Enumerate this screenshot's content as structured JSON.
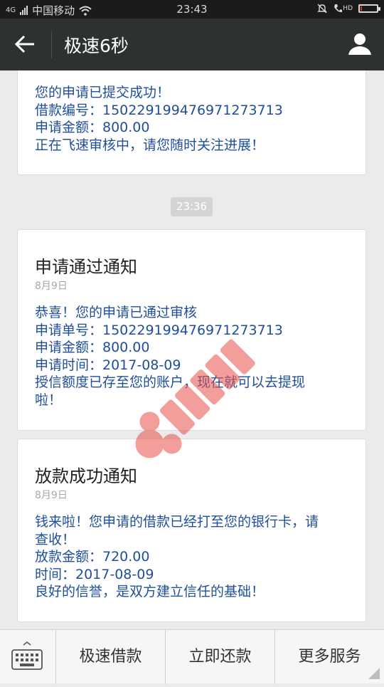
{
  "status_bar": {
    "signal_text": "4G",
    "carrier": "中国移动",
    "time": "23:43",
    "hd": "HD",
    "battery_level": 0.08,
    "battery_color": "#e03030"
  },
  "header": {
    "back_icon": "arrow-left-icon",
    "title": "极速6秒",
    "profile_icon": "person-icon"
  },
  "messages": [
    {
      "lines": [
        "您的申请已提交成功！",
        "借款编号：150229199476971273713",
        "申请金额：800.00",
        "正在飞速审核中，请您随时关注进展！"
      ]
    },
    {
      "timestamp": "23:36"
    },
    {
      "title": "申请通过通知",
      "date": "8月9日",
      "lines": [
        "恭喜！您的申请已通过审核",
        "申请单号：150229199476971273713",
        "申请金额：800.00",
        "申请时间：2017-08-09",
        "授信额度已存至您的账户，现在就可以去提现",
        "啦！"
      ]
    },
    {
      "title": "放款成功通知",
      "date": "8月9日",
      "lines": [
        "钱来啦！您申请的借款已经打至您的银行卡，请",
        "查收！",
        "放款金额：720.00",
        "时间：2017-08-09",
        "良好的信誉，是双方建立信任的基础！"
      ]
    }
  ],
  "bottom_bar": {
    "keyboard_icon": "keyboard-icon",
    "items": [
      "极速借款",
      "立即还款",
      "更多服务"
    ]
  },
  "colors": {
    "header_bg": "#2e3132",
    "message_text": "#1f4e9c",
    "watermark": "#e8504a"
  }
}
